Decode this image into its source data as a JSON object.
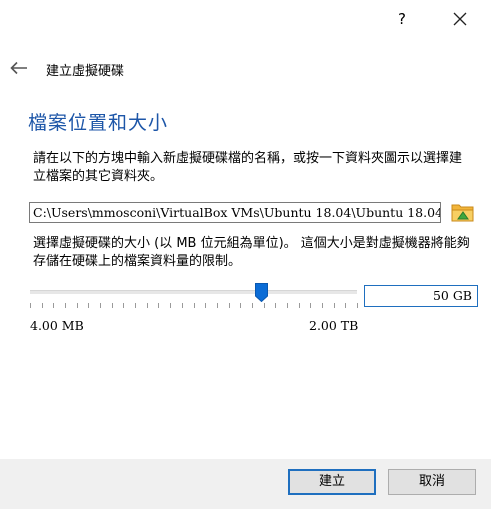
{
  "titlebar": {
    "help_label": "?"
  },
  "header": {
    "title": "建立虛擬硬碟"
  },
  "page": {
    "heading": "檔案位置和大小",
    "description_location": "請在以下的方塊中輸入新虛擬硬碟檔的名稱，或按一下資料夾圖示以選擇建立檔案的其它資料夾。",
    "file_path": "C:\\Users\\mmosconi\\VirtualBox VMs\\Ubuntu 18.04\\Ubuntu 18.04",
    "description_size": "選擇虛擬硬碟的大小 (以 MB 位元組為單位)。 這個大小是對虛擬機器將能夠存儲在硬碟上的檔案資料量的限制。",
    "size_value": "50 GB",
    "slider_min_label": "4.00 MB",
    "slider_max_label": "2.00 TB",
    "slider_position_fraction": 0.705
  },
  "buttons": {
    "create_label": "建立",
    "cancel_label": "取消"
  },
  "icons": {
    "help": "question-mark-icon",
    "close": "close-icon",
    "back": "arrow-left-icon",
    "folder": "folder-icon",
    "slider_thumb": "slider-thumb-icon"
  },
  "colors": {
    "accent": "#1f6fbf",
    "heading": "#1d56a8",
    "footer": "#f0f0f0"
  }
}
